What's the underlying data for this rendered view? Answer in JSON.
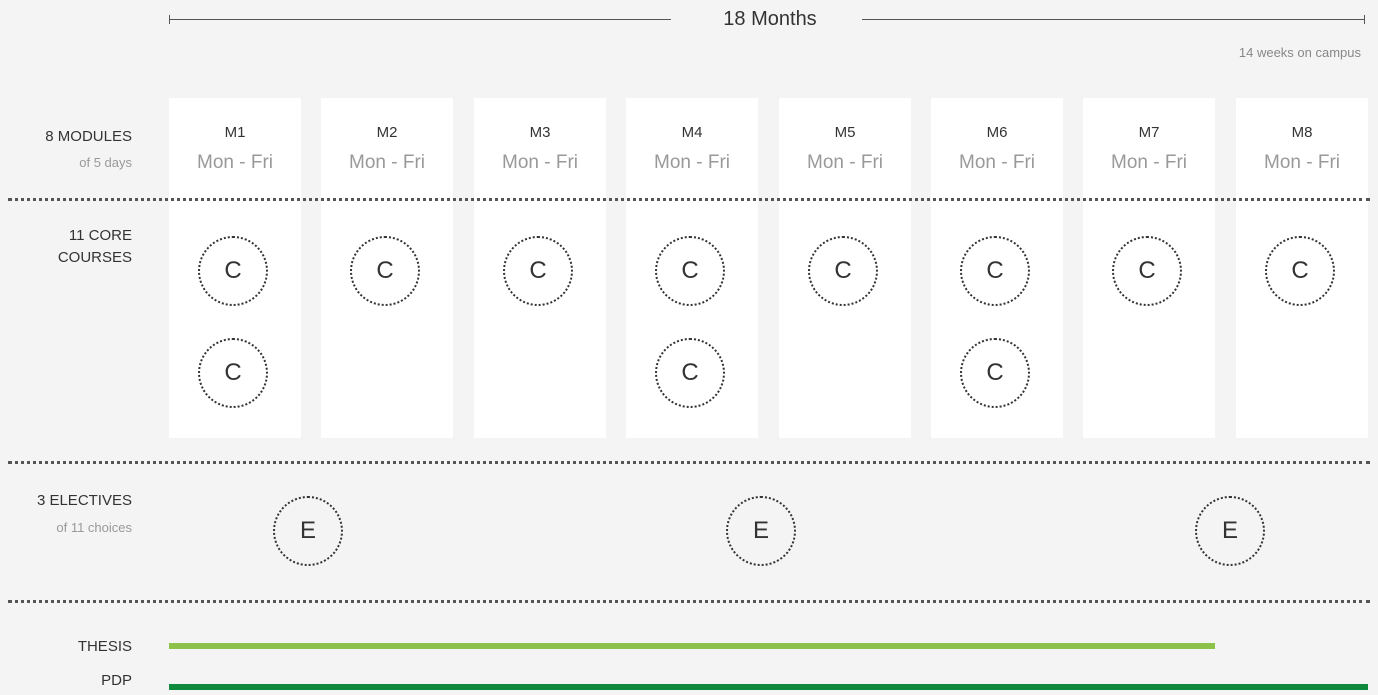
{
  "header": {
    "duration": "18 Months",
    "campus_note": "14 weeks on campus"
  },
  "rows": {
    "modules_label": "8 MODULES",
    "modules_sub": "of 5 days",
    "core_label_1": "11 CORE",
    "core_label_2": "COURSES",
    "electives_label": "3 ELECTIVES",
    "electives_sub": "of 11 choices"
  },
  "modules": [
    {
      "name": "M1",
      "days": "Mon - Fri",
      "core_courses": 2
    },
    {
      "name": "M2",
      "days": "Mon - Fri",
      "core_courses": 1
    },
    {
      "name": "M3",
      "days": "Mon - Fri",
      "core_courses": 1
    },
    {
      "name": "M4",
      "days": "Mon - Fri",
      "core_courses": 2
    },
    {
      "name": "M5",
      "days": "Mon - Fri",
      "core_courses": 1
    },
    {
      "name": "M6",
      "days": "Mon - Fri",
      "core_courses": 2
    },
    {
      "name": "M7",
      "days": "Mon - Fri",
      "core_courses": 1
    },
    {
      "name": "M8",
      "days": "Mon - Fri",
      "core_courses": 1
    }
  ],
  "core_symbol": "C",
  "elective_symbol": "E",
  "tracks": [
    {
      "label": "THESIS",
      "color": "#8cc24a",
      "span_modules": 7
    },
    {
      "label": "PDP",
      "color": "#0f8a3c",
      "span_modules": 8
    }
  ]
}
